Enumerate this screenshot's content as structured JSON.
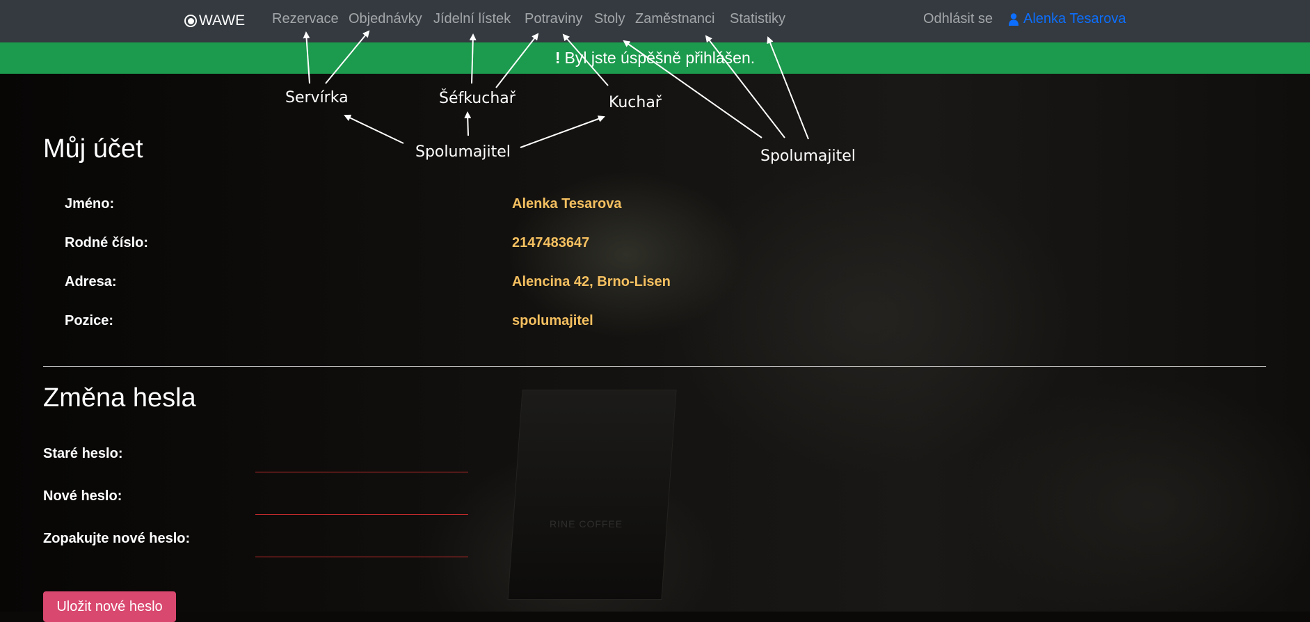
{
  "navbar": {
    "brand": "WAWE",
    "links": [
      {
        "label": "Rezervace"
      },
      {
        "label": "Objednávky"
      },
      {
        "label": "Jídelní lístek"
      },
      {
        "label": "Potraviny"
      },
      {
        "label": "Stoly"
      },
      {
        "label": "Zaměstnanci"
      },
      {
        "label": "Statistiky"
      }
    ],
    "logout": "Odhlásit se",
    "user": "Alenka Tesarova"
  },
  "alert": {
    "icon": "exclamation-icon",
    "symbol": "!",
    "message": "Byl jste úspěšně přihlášen.",
    "color": "#1c9a4d"
  },
  "annotations": {
    "servirka": "Servírka",
    "sefkuchar": "Šéfkuchař",
    "kuchar": "Kuchař",
    "spolumajitel_left": "Spolumajitel",
    "spolumajitel_right": "Spolumajitel"
  },
  "account": {
    "title": "Můj účet",
    "rows": [
      {
        "label": "Jméno:",
        "value": "Alenka Tesarova"
      },
      {
        "label": "Rodné číslo:",
        "value": "2147483647"
      },
      {
        "label": "Adresa:",
        "value": "Alencina 42, Brno-Lisen"
      },
      {
        "label": "Pozice:",
        "value": "spolumajitel"
      }
    ],
    "value_color": "#f5c060"
  },
  "password": {
    "title": "Změna hesla",
    "old_label": "Staré heslo:",
    "new_label": "Nové heslo:",
    "repeat_label": "Zopakujte nové heslo:",
    "old_value": "",
    "new_value": "",
    "repeat_value": "",
    "save_label": "Uložit nové heslo",
    "button_color": "#d9486f"
  },
  "colors": {
    "navbar": "#343a40",
    "user_link": "#0d6efd"
  }
}
